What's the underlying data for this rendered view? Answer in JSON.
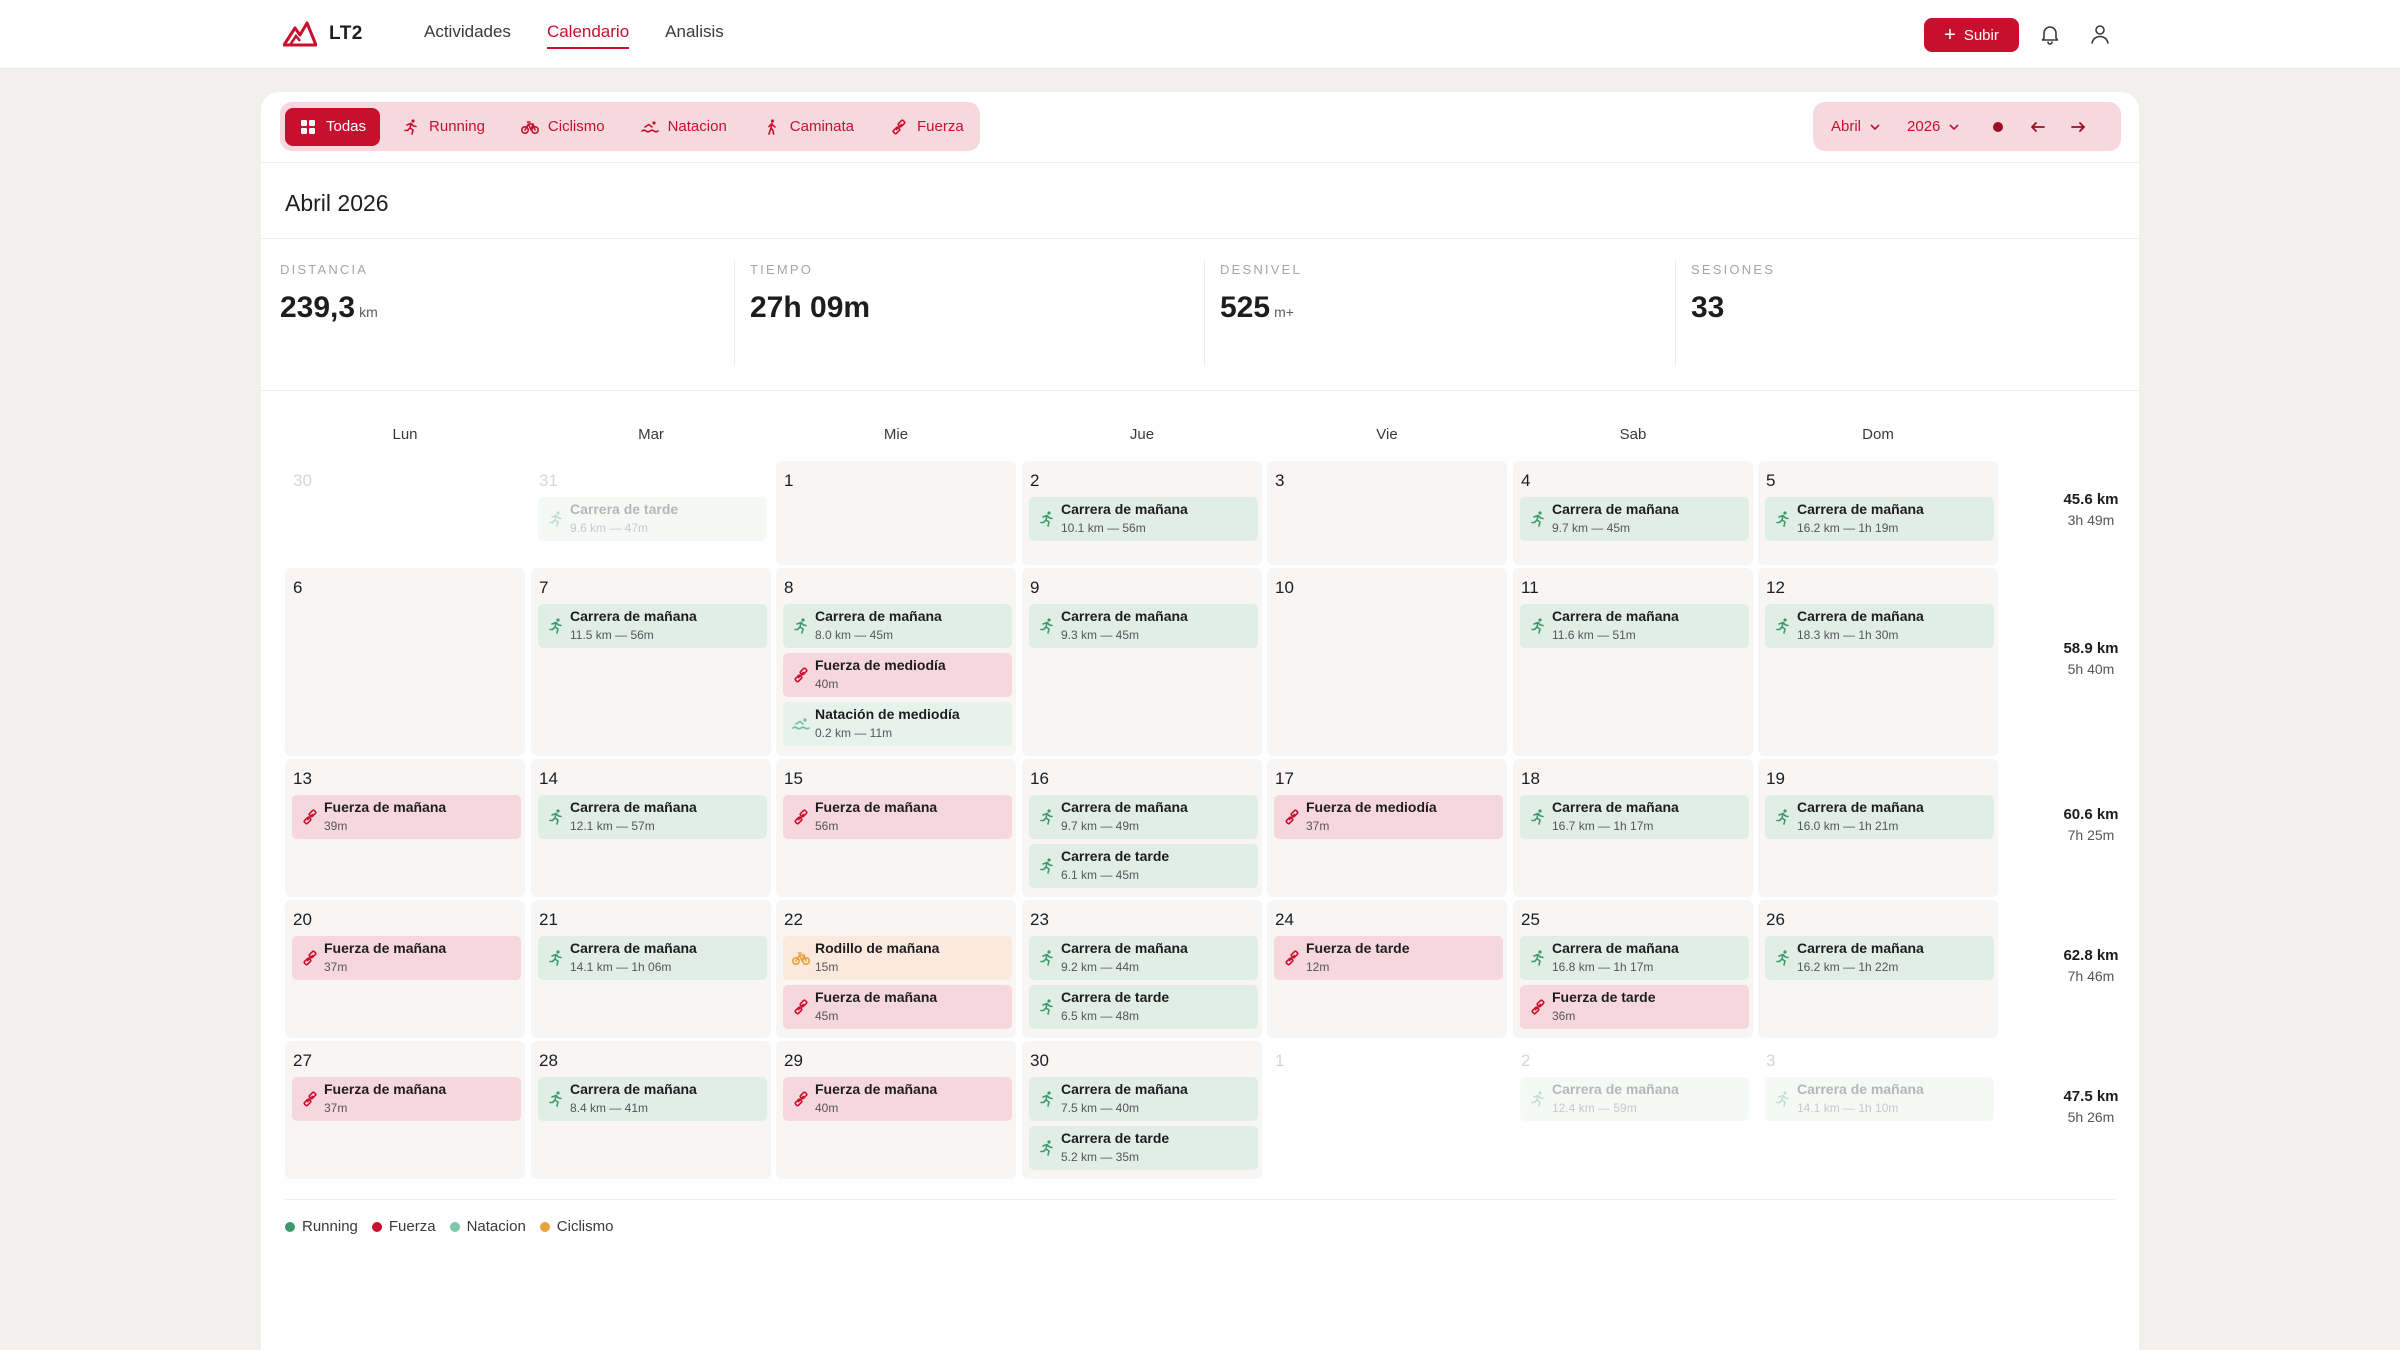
{
  "app": {
    "name": "LT2",
    "brand_color": "#c8102e"
  },
  "nav": [
    {
      "label": "Actividades",
      "active": false
    },
    {
      "label": "Calendario",
      "active": true
    },
    {
      "label": "Analisis",
      "active": false
    }
  ],
  "topbar": {
    "upload_label": "Subir",
    "notifications_icon": "bell-icon",
    "user_icon": "user-icon"
  },
  "filters": [
    {
      "label": "Todas",
      "icon": "grid-icon",
      "active": true
    },
    {
      "label": "Running",
      "icon": "running-icon",
      "active": false
    },
    {
      "label": "Ciclismo",
      "icon": "bike-icon",
      "active": false
    },
    {
      "label": "Natacion",
      "icon": "swim-icon",
      "active": false
    },
    {
      "label": "Caminata",
      "icon": "walk-icon",
      "active": false
    },
    {
      "label": "Fuerza",
      "icon": "dumbbell-icon",
      "active": false
    }
  ],
  "date_controls": {
    "month": "Abril",
    "year": "2026"
  },
  "title": "Abril 2026",
  "stats": [
    {
      "label": "Distancia",
      "value": "239,3",
      "unit": "km"
    },
    {
      "label": "Tiempo",
      "value": "27h 09m",
      "unit": ""
    },
    {
      "label": "Desnivel",
      "value": "525",
      "unit": "m+"
    },
    {
      "label": "Sesiones",
      "value": "33",
      "unit": ""
    }
  ],
  "weekdays": [
    "Lun",
    "Mar",
    "Mie",
    "Jue",
    "Vie",
    "Sab",
    "Dom"
  ],
  "weeks": [
    {
      "total_km": "45.6 km",
      "total_time": "3h 49m",
      "days": [
        {
          "day": "30",
          "outside": true,
          "events": []
        },
        {
          "day": "31",
          "outside": true,
          "events": [
            {
              "type": "run",
              "title": "Carrera de tarde",
              "meta": "9.6 km — 47m"
            }
          ]
        },
        {
          "day": "1",
          "outside": false,
          "events": []
        },
        {
          "day": "2",
          "outside": false,
          "events": [
            {
              "type": "run",
              "title": "Carrera de mañana",
              "meta": "10.1 km — 56m"
            }
          ]
        },
        {
          "day": "3",
          "outside": false,
          "events": []
        },
        {
          "day": "4",
          "outside": false,
          "events": [
            {
              "type": "run",
              "title": "Carrera de mañana",
              "meta": "9.7 km — 45m"
            }
          ]
        },
        {
          "day": "5",
          "outside": false,
          "events": [
            {
              "type": "run",
              "title": "Carrera de mañana",
              "meta": "16.2 km — 1h 19m"
            }
          ]
        }
      ]
    },
    {
      "total_km": "58.9 km",
      "total_time": "5h 40m",
      "days": [
        {
          "day": "6",
          "outside": false,
          "events": []
        },
        {
          "day": "7",
          "outside": false,
          "events": [
            {
              "type": "run",
              "title": "Carrera de mañana",
              "meta": "11.5 km — 56m"
            }
          ]
        },
        {
          "day": "8",
          "outside": false,
          "events": [
            {
              "type": "run",
              "title": "Carrera de mañana",
              "meta": "8.0 km — 45m"
            },
            {
              "type": "str",
              "title": "Fuerza de mediodía",
              "meta": "40m"
            },
            {
              "type": "swim",
              "title": "Natación de mediodía",
              "meta": "0.2 km — 11m"
            }
          ]
        },
        {
          "day": "9",
          "outside": false,
          "events": [
            {
              "type": "run",
              "title": "Carrera de mañana",
              "meta": "9.3 km — 45m"
            }
          ]
        },
        {
          "day": "10",
          "outside": false,
          "events": []
        },
        {
          "day": "11",
          "outside": false,
          "events": [
            {
              "type": "run",
              "title": "Carrera de mañana",
              "meta": "11.6 km — 51m"
            }
          ]
        },
        {
          "day": "12",
          "outside": false,
          "events": [
            {
              "type": "run",
              "title": "Carrera de mañana",
              "meta": "18.3 km — 1h 30m"
            }
          ]
        }
      ]
    },
    {
      "total_km": "60.6 km",
      "total_time": "7h 25m",
      "days": [
        {
          "day": "13",
          "outside": false,
          "events": [
            {
              "type": "str",
              "title": "Fuerza de mañana",
              "meta": "39m"
            }
          ]
        },
        {
          "day": "14",
          "outside": false,
          "events": [
            {
              "type": "run",
              "title": "Carrera de mañana",
              "meta": "12.1 km — 57m"
            }
          ]
        },
        {
          "day": "15",
          "outside": false,
          "events": [
            {
              "type": "str",
              "title": "Fuerza de mañana",
              "meta": "56m"
            }
          ]
        },
        {
          "day": "16",
          "outside": false,
          "events": [
            {
              "type": "run",
              "title": "Carrera de mañana",
              "meta": "9.7 km — 49m"
            },
            {
              "type": "run",
              "title": "Carrera de tarde",
              "meta": "6.1 km — 45m"
            }
          ]
        },
        {
          "day": "17",
          "outside": false,
          "events": [
            {
              "type": "str",
              "title": "Fuerza de mediodía",
              "meta": "37m"
            }
          ]
        },
        {
          "day": "18",
          "outside": false,
          "events": [
            {
              "type": "run",
              "title": "Carrera de mañana",
              "meta": "16.7 km — 1h 17m"
            }
          ]
        },
        {
          "day": "19",
          "outside": false,
          "events": [
            {
              "type": "run",
              "title": "Carrera de mañana",
              "meta": "16.0 km — 1h 21m"
            }
          ]
        }
      ]
    },
    {
      "total_km": "62.8 km",
      "total_time": "7h 46m",
      "days": [
        {
          "day": "20",
          "outside": false,
          "events": [
            {
              "type": "str",
              "title": "Fuerza de mañana",
              "meta": "37m"
            }
          ]
        },
        {
          "day": "21",
          "outside": false,
          "events": [
            {
              "type": "run",
              "title": "Carrera de mañana",
              "meta": "14.1 km — 1h 06m"
            }
          ]
        },
        {
          "day": "22",
          "outside": false,
          "events": [
            {
              "type": "bike",
              "title": "Rodillo de mañana",
              "meta": "15m"
            },
            {
              "type": "str",
              "title": "Fuerza de mañana",
              "meta": "45m"
            }
          ]
        },
        {
          "day": "23",
          "outside": false,
          "events": [
            {
              "type": "run",
              "title": "Carrera de mañana",
              "meta": "9.2 km — 44m"
            },
            {
              "type": "run",
              "title": "Carrera de tarde",
              "meta": "6.5 km — 48m"
            }
          ]
        },
        {
          "day": "24",
          "outside": false,
          "events": [
            {
              "type": "str",
              "title": "Fuerza de tarde",
              "meta": "12m"
            }
          ]
        },
        {
          "day": "25",
          "outside": false,
          "events": [
            {
              "type": "run",
              "title": "Carrera de mañana",
              "meta": "16.8 km — 1h 17m"
            },
            {
              "type": "str",
              "title": "Fuerza de tarde",
              "meta": "36m"
            }
          ]
        },
        {
          "day": "26",
          "outside": false,
          "events": [
            {
              "type": "run",
              "title": "Carrera de mañana",
              "meta": "16.2 km — 1h 22m"
            }
          ]
        }
      ]
    },
    {
      "total_km": "47.5 km",
      "total_time": "5h 26m",
      "days": [
        {
          "day": "27",
          "outside": false,
          "events": [
            {
              "type": "str",
              "title": "Fuerza de mañana",
              "meta": "37m"
            }
          ]
        },
        {
          "day": "28",
          "outside": false,
          "events": [
            {
              "type": "run",
              "title": "Carrera de mañana",
              "meta": "8.4 km — 41m"
            }
          ]
        },
        {
          "day": "29",
          "outside": false,
          "events": [
            {
              "type": "str",
              "title": "Fuerza de mañana",
              "meta": "40m"
            }
          ]
        },
        {
          "day": "30",
          "outside": false,
          "events": [
            {
              "type": "run",
              "title": "Carrera de mañana",
              "meta": "7.5 km — 40m"
            },
            {
              "type": "run",
              "title": "Carrera de tarde",
              "meta": "5.2 km — 35m"
            }
          ]
        },
        {
          "day": "1",
          "outside": true,
          "events": []
        },
        {
          "day": "2",
          "outside": true,
          "events": [
            {
              "type": "run",
              "title": "Carrera de mañana",
              "meta": "12.4 km — 59m"
            }
          ]
        },
        {
          "day": "3",
          "outside": true,
          "events": [
            {
              "type": "run",
              "title": "Carrera de mañana",
              "meta": "14.1 km — 1h 10m"
            }
          ]
        }
      ]
    }
  ],
  "legend": [
    {
      "label": "Running",
      "color": "#3f9a6b"
    },
    {
      "label": "Fuerza",
      "color": "#c8102e"
    },
    {
      "label": "Natacion",
      "color": "#7cc7a8"
    },
    {
      "label": "Ciclismo",
      "color": "#e8a23a"
    }
  ]
}
